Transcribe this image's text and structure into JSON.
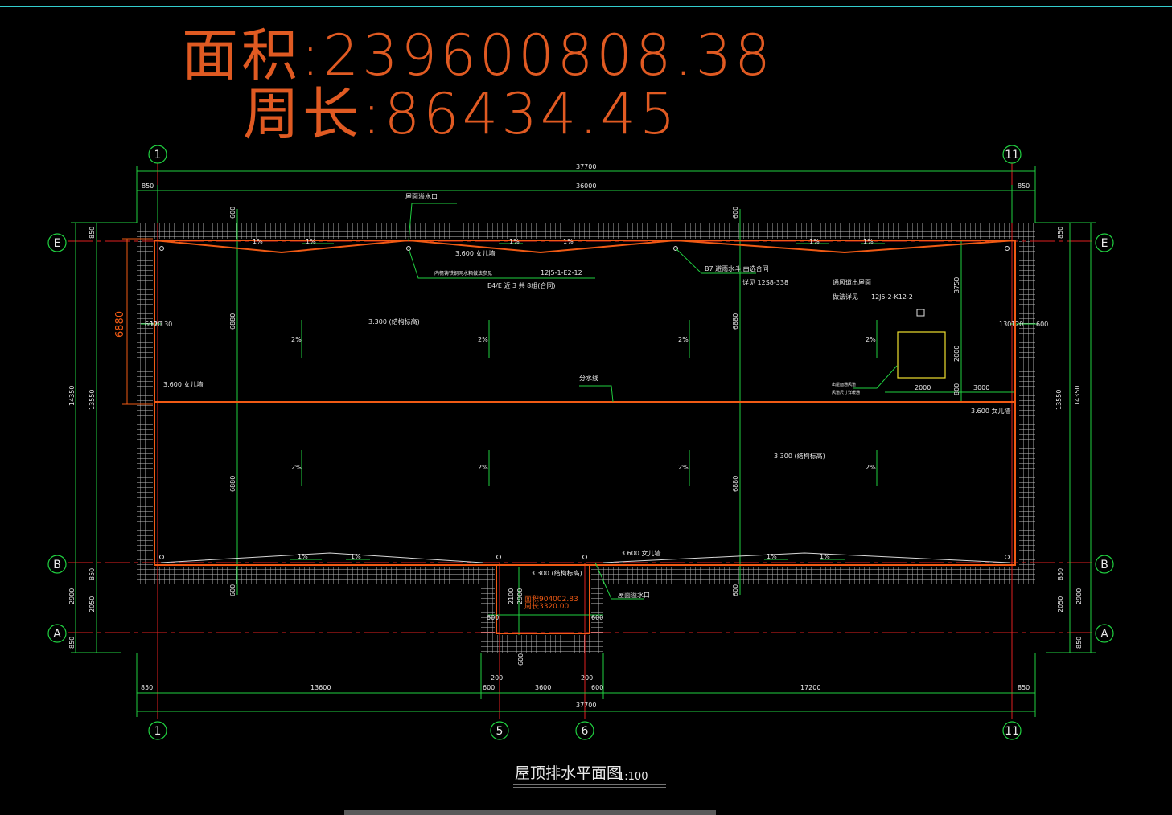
{
  "area_label": "面积:239600808.38",
  "perimeter_label": "周长:86434.45",
  "title": "屋顶排水平面图",
  "scale": "1:100",
  "grid": {
    "c1": "1",
    "c5": "5",
    "c6": "6",
    "c11": "11",
    "rE": "E",
    "rB": "B",
    "rA": "A"
  },
  "dims": {
    "top_total": "37700",
    "top_mid": "36000",
    "edge": "850",
    "bot_13600": "13600",
    "bot_600a": "600",
    "bot_3600": "3600",
    "bot_600b": "600",
    "bot_17200": "17200",
    "bot_200a": "200",
    "bot_200b": "200",
    "left_14350": "14350",
    "left_13550": "13550",
    "left_6880": "6880",
    "side_850": "850",
    "side_2900": "2900",
    "side_2050": "2050",
    "d600": "600",
    "d120": "120",
    "d130": "130",
    "d3750": "3750",
    "d2000": "2000",
    "d800": "800",
    "d3000": "3000",
    "d2100": "2100",
    "d2900": "2900"
  },
  "notes": {
    "drain_top": "屋面溢水口",
    "drain_bottom": "屋面溢水口",
    "parapet_top": "3.600  女儿墙",
    "parapet_left": "3.600  女儿墙",
    "parapet_right": "3.600  女儿墙",
    "parapet_bottom": "3.600  女儿墙",
    "struct1": "3.300 (结构标高)",
    "struct2": "3.300 (结构标高)",
    "struct3": "3.300 (结构标高)",
    "note_pipe": "内檐铸铁钢网水箱做法参见",
    "note_pipe_ref": "12J5-1-E2-12",
    "note_pipe_sub": "E4/E 近 3 共 8组(合同)",
    "note_b7": "B7 避雨水斗,由选合同",
    "note_b7_ref": "详见 12S8-338",
    "note_vent1": "通风道出屋面",
    "note_vent2": "做法详见",
    "note_vent_ref": "12J5-2-K12-2",
    "note_vent_box1": "出屋面通风道",
    "note_vent_box2": "风道尺寸详暖通",
    "ridge": "分水线",
    "slope1": "1%",
    "slope2": "2%",
    "small_area": "面积904002.83",
    "small_perim": "周长3320.00"
  }
}
